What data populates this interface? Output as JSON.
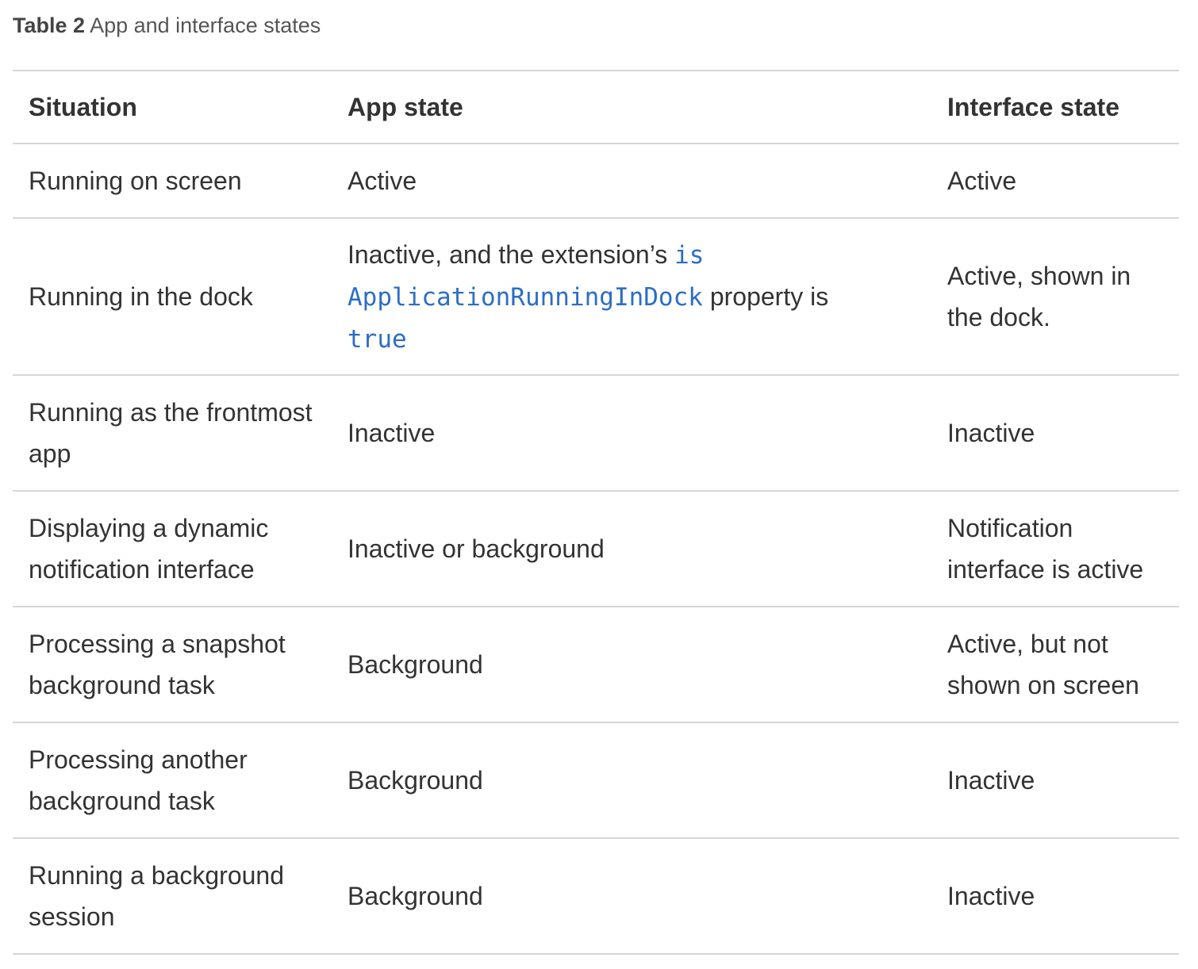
{
  "caption": {
    "label": "Table 2",
    "text": "App and interface states"
  },
  "table": {
    "headers": [
      "Situation",
      "App state",
      "Interface state"
    ],
    "rows": [
      {
        "situation": "Running on screen",
        "app_state": "Active",
        "interface_state": "Active"
      },
      {
        "situation": "Running in the dock",
        "app_state": {
          "prefix": "Inactive, and the extension’s",
          "code_1": "is",
          "code_2": "ApplicationRunningInDock",
          "middle": "property is",
          "code_3": "true"
        },
        "interface_state": "Active, shown in the dock."
      },
      {
        "situation": "Running as the frontmost app",
        "app_state": "Inactive",
        "interface_state": "Inactive"
      },
      {
        "situation": "Displaying a dynamic notification interface",
        "app_state": "Inactive or background",
        "interface_state": "Notification interface is active"
      },
      {
        "situation": "Processing a snapshot background task",
        "app_state": "Background",
        "interface_state": "Active, but not shown on screen"
      },
      {
        "situation": "Processing another background task",
        "app_state": "Background",
        "interface_state": "Inactive"
      },
      {
        "situation": "Running a background session",
        "app_state": "Background",
        "interface_state": "Inactive"
      }
    ]
  },
  "colors": {
    "text": "#333333",
    "code_link": "#2c6ec4",
    "rule": "#d6d6d6"
  }
}
